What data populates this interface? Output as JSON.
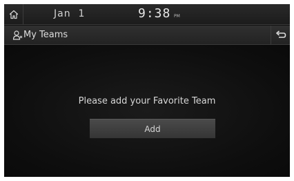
{
  "status_bar": {
    "home_icon": "home-icon",
    "date": "Jan  1",
    "time": "9:38",
    "ampm": "PM"
  },
  "header": {
    "icon": "person-icon",
    "title": "My Teams",
    "back_icon": "back-arrow-icon"
  },
  "main": {
    "prompt": "Please add your Favorite Team",
    "add_label": "Add"
  },
  "colors": {
    "background": "#101010",
    "bar": "#262626",
    "button": "#404040",
    "text": "#d8d8d8"
  }
}
